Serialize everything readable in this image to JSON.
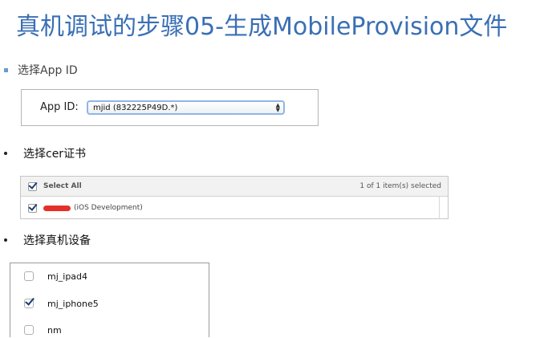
{
  "title": "真机调试的步骤05-生成MobileProvision文件",
  "steps": {
    "appid": {
      "label": "选择App ID"
    },
    "cer": {
      "label": "选择cer证书"
    },
    "device": {
      "label": "选择真机设备"
    }
  },
  "appid_panel": {
    "label": "App ID:",
    "selected": "mjid (832225P49D.*)"
  },
  "cert_table": {
    "select_all": "Select All",
    "count": "1 of 1 item(s) selected",
    "rows": [
      {
        "name_suffix": "(iOS Development)",
        "checked": true
      }
    ]
  },
  "devices": [
    {
      "name": "mj_ipad4",
      "checked": false
    },
    {
      "name": "mj_iphone5",
      "checked": true
    },
    {
      "name": "nm",
      "checked": false
    }
  ],
  "colors": {
    "title": "#3a6fb5",
    "bullet": "#6a9ad1",
    "check": "#1d3f73",
    "redaction": "#e5302a"
  }
}
